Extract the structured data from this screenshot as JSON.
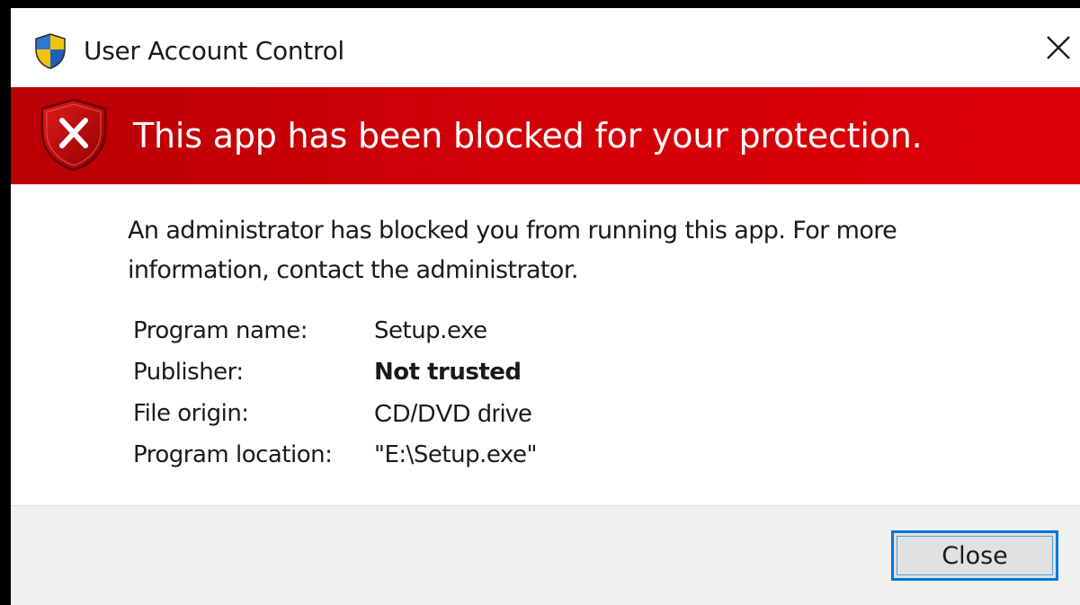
{
  "window": {
    "title": "User Account Control",
    "title_icon": "uac-shield-icon",
    "close_icon": "close-icon"
  },
  "banner": {
    "icon": "error-shield-icon",
    "heading": "This app has been blocked for your protection."
  },
  "body": {
    "message": "An administrator has blocked you from running this app. For more information, contact the administrator."
  },
  "details": [
    {
      "label": "Program name:",
      "value": "Setup.exe"
    },
    {
      "label": "Publisher:",
      "value": "Not trusted"
    },
    {
      "label": "File origin:",
      "value": "CD/DVD drive"
    },
    {
      "label": "Program location:",
      "value": "\"E:\\Setup.exe\""
    }
  ],
  "footer": {
    "close_label": "Close"
  },
  "colors": {
    "banner_red": "#d10007",
    "focus_blue": "#0078d7",
    "footer_gray": "#f0f0f0"
  }
}
